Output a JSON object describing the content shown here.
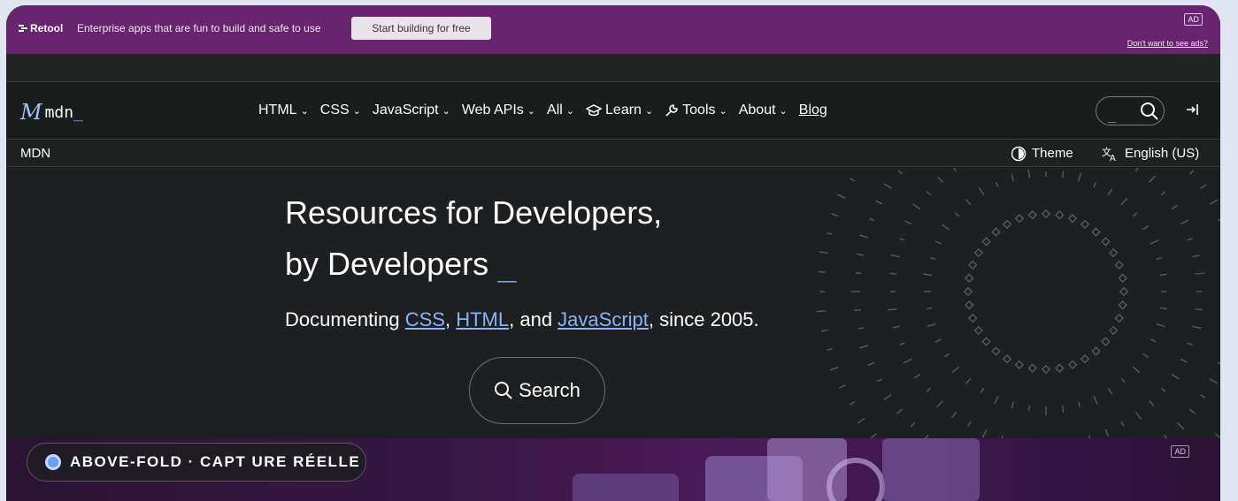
{
  "ad": {
    "brand": "Retool",
    "copy": "Enterprise apps that are fun to build and safe to use",
    "cta": "Start building for free",
    "badge": "AD",
    "dismiss": "Don't want to see ads?"
  },
  "nav": {
    "logo": "mdn",
    "logo_cursor": "_",
    "items": [
      {
        "label": "HTML"
      },
      {
        "label": "CSS"
      },
      {
        "label": "JavaScript"
      },
      {
        "label": "Web APIs"
      },
      {
        "label": "All"
      },
      {
        "label": "Learn"
      },
      {
        "label": "Tools"
      },
      {
        "label": "About"
      }
    ],
    "blog": "Blog",
    "search_cursor": "_"
  },
  "crumb": {
    "root": "MDN",
    "theme": "Theme",
    "language": "English (US)"
  },
  "hero": {
    "line1": "Resources for Developers,",
    "line2": "by Developers",
    "cursor": "_",
    "sub_prefix": "Documenting ",
    "link_css": "CSS",
    "sep1": ", ",
    "link_html": "HTML",
    "sep2": ", and ",
    "link_js": "JavaScript",
    "sub_suffix": ", since 2005.",
    "search_button": "Search"
  },
  "lower": {
    "badge": "AD",
    "pill": "ABOVE-FOLD · CAPT URE RÉELLE"
  },
  "colors": {
    "ad_bg": "#68246e",
    "accent": "#8ab4f8"
  }
}
